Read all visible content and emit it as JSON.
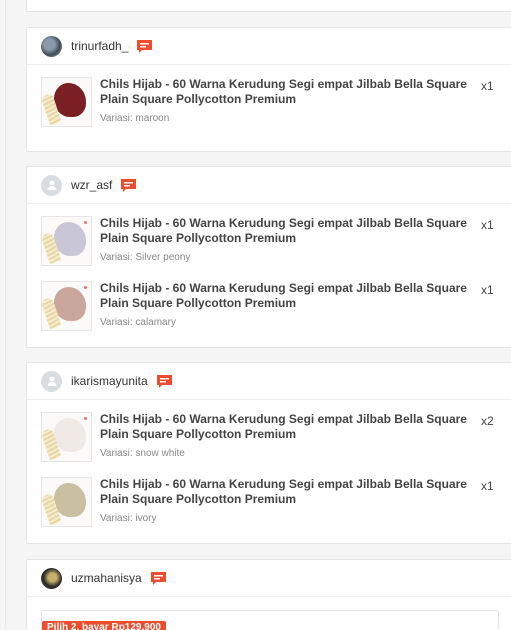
{
  "orders": [
    {
      "username": "trinurfadh_",
      "items": [
        {
          "title": "Chils Hijab - 60 Warna Kerudung Segi empat Jilbab Bella Square Plain Square Pollycotton Premium",
          "variant": "Variasi: maroon",
          "qty": "x1",
          "color": "#7a1f24"
        }
      ]
    },
    {
      "username": "wzr_asf",
      "items": [
        {
          "title": "Chils Hijab - 60 Warna Kerudung Segi empat Jilbab Bella Square Plain Square Pollycotton Premium",
          "variant": "Variasi: Silver peony",
          "qty": "x1",
          "color": "#c9c6d6"
        },
        {
          "title": "Chils Hijab - 60 Warna Kerudung Segi empat Jilbab Bella Square Plain Square Pollycotton Premium",
          "variant": "Variasi: calamary",
          "qty": "x1",
          "color": "#c9a79c"
        }
      ]
    },
    {
      "username": "ikarismayunita",
      "items": [
        {
          "title": "Chils Hijab - 60 Warna Kerudung Segi empat Jilbab Bella Square Plain Square Pollycotton Premium",
          "variant": "Variasi: snow white",
          "qty": "x2",
          "color": "#efeae6"
        },
        {
          "title": "Chils Hijab - 60 Warna Kerudung Segi empat Jilbab Bella Square Plain Square Pollycotton Premium",
          "variant": "Variasi: ivory",
          "qty": "x1",
          "color": "#c9c0a2"
        }
      ]
    },
    {
      "username": "uzmahanisya",
      "promo": "Pilih 2, bayar Rp129.900"
    }
  ],
  "colors": {
    "accent": "#ee4d2d",
    "chat_icon": "#ee4d2d"
  },
  "icons": {
    "chat": "chat-icon",
    "avatar_default": "user-avatar-icon"
  }
}
